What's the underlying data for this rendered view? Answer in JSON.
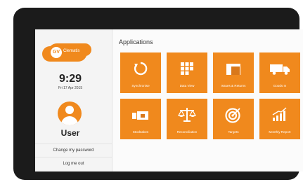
{
  "sidebar": {
    "logo_text": "Clematis",
    "logo_mark": "GV",
    "time": "9:29",
    "date": "Fri 17 Apr 2015",
    "username": "User",
    "links": [
      "Change my password",
      "Log me out"
    ]
  },
  "main": {
    "heading": "Applications",
    "tiles": [
      {
        "label": "Synchronise",
        "icon": "sync-icon"
      },
      {
        "label": "Data View",
        "icon": "grid-icon"
      },
      {
        "label": "Issues & Returns",
        "icon": "box-icon"
      },
      {
        "label": "Goods In",
        "icon": "truck-icon"
      },
      {
        "label": "Stocktakes",
        "icon": "stock-icon"
      },
      {
        "label": "Reconciliation",
        "icon": "scales-icon"
      },
      {
        "label": "Targets",
        "icon": "target-icon"
      },
      {
        "label": "Monthly Report",
        "icon": "bar-chart-icon"
      }
    ]
  },
  "colors": {
    "accent": "#f0891d",
    "frame": "#1b1b1b"
  }
}
